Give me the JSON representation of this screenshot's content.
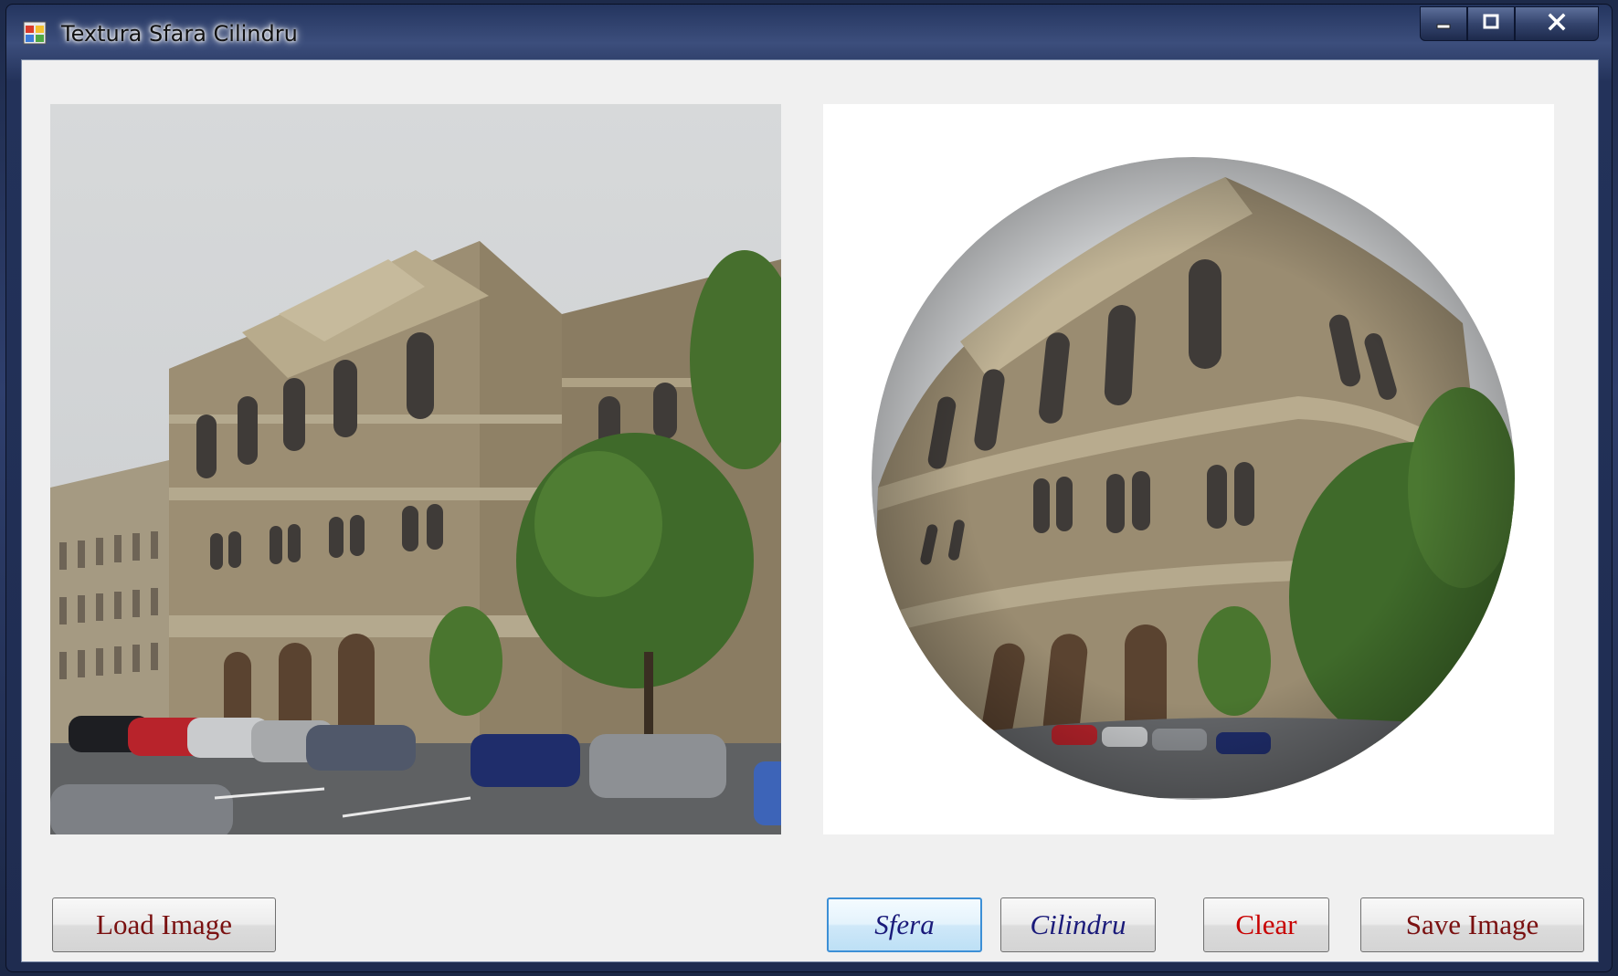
{
  "window": {
    "title": "Textura Sfara Cilindru",
    "controls": {
      "minimize": "minimize",
      "maximize": "maximize",
      "close": "close"
    }
  },
  "buttons": {
    "load": "Load Image",
    "sfera": "Sfera",
    "cilindru": "Cilindru",
    "clear": "Clear",
    "save": "Save Image"
  },
  "icons": {
    "app": "app-icon",
    "minimize": "minimize-icon",
    "maximize": "maximize-icon",
    "close": "close-icon"
  },
  "colors": {
    "window_frame": "#23325a",
    "client_bg": "#f0f0f0",
    "button_text_red": "#7a1010",
    "button_text_blue": "#1a1a7a",
    "clear_text": "#c80000",
    "focused_border": "#3c8fd6"
  }
}
